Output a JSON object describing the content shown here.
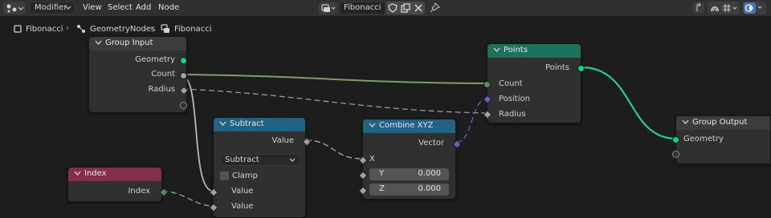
{
  "header": {
    "editor_type_icon": "node-editor-icon",
    "mode": "Modifier",
    "menus": [
      "View",
      "Select",
      "Add",
      "Node"
    ],
    "tree_name": "Fibonacci",
    "icons": [
      "fake-user-shield-icon",
      "duplicate-icon",
      "close-icon",
      "pin-icon"
    ],
    "right_icons": [
      "parent-icon",
      "snap-icon",
      "grid-icon",
      "overlay-icon"
    ]
  },
  "breadcrumbs": [
    "Fibonacci",
    "GeometryNodes",
    "Fibonacci"
  ],
  "nodes": {
    "group_input": {
      "title": "Group Input",
      "outputs": [
        "Geometry",
        "Count",
        "Radius"
      ]
    },
    "points": {
      "title": "Points",
      "output": "Points",
      "inputs": [
        "Count",
        "Position",
        "Radius"
      ]
    },
    "subtract": {
      "title": "Subtract",
      "output": "Value",
      "operation": "Subtract",
      "clamp": "Clamp",
      "inputs": [
        "Value",
        "Value"
      ]
    },
    "combine_xyz": {
      "title": "Combine XYZ",
      "output": "Vector",
      "inputs": [
        {
          "label": "X"
        },
        {
          "label": "Y",
          "value": "0.000"
        },
        {
          "label": "Z",
          "value": "0.000"
        }
      ]
    },
    "index": {
      "title": "Index",
      "output": "Index"
    },
    "group_output": {
      "title": "Group Output",
      "inputs": [
        "Geometry"
      ]
    }
  },
  "colors": {
    "geometry_socket": "#00d6a3",
    "vector_socket": "#6363c7",
    "float_socket": "#a1a1a1",
    "int_socket": "#598c5c",
    "geometry_header": "#1d725e",
    "function_header": "#246283",
    "input_header": "#83314a",
    "group_header": "#3c3c3c"
  }
}
